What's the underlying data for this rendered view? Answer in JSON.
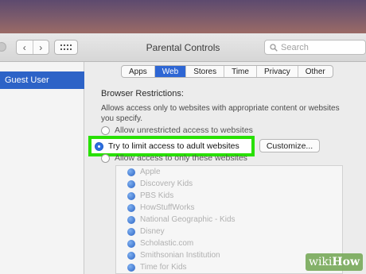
{
  "window": {
    "title": "Parental Controls"
  },
  "toolbar": {
    "back": "‹",
    "forward": "›",
    "search_placeholder": "Search"
  },
  "sidebar": {
    "items": [
      {
        "label": "Guest User",
        "selected": true
      }
    ]
  },
  "tabs": [
    {
      "label": "Apps",
      "active": false
    },
    {
      "label": "Web",
      "active": true
    },
    {
      "label": "Stores",
      "active": false
    },
    {
      "label": "Time",
      "active": false
    },
    {
      "label": "Privacy",
      "active": false
    },
    {
      "label": "Other",
      "active": false
    }
  ],
  "web": {
    "section_title": "Browser Restrictions:",
    "description": "Allows access only to websites with appropriate content or websites you specify.",
    "options": [
      {
        "label": "Allow unrestricted access to websites",
        "selected": false
      },
      {
        "label": "Try to limit access to adult websites",
        "selected": true
      },
      {
        "label": "Allow access to only these websites",
        "selected": false
      }
    ],
    "customize_label": "Customize...",
    "sites": [
      "Apple",
      "Discovery Kids",
      "PBS Kids",
      "HowStuffWorks",
      "National Geographic - Kids",
      "Disney",
      "Scholastic.com",
      "Smithsonian Institution",
      "Time for Kids"
    ]
  },
  "watermark": {
    "prefix": "wiki",
    "suffix": "How"
  },
  "colors": {
    "selection_blue": "#2d63c7",
    "highlight_green": "#28e000"
  }
}
